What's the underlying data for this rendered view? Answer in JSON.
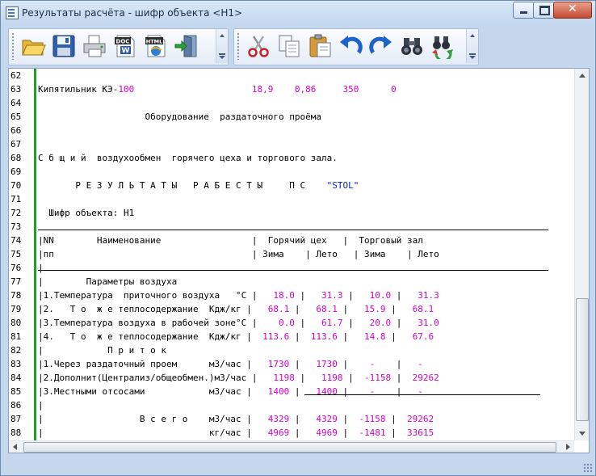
{
  "window": {
    "title": "Результаты расчёта - шифр объекта <Н1>"
  },
  "toolbar1": [
    {
      "name": "open-folder"
    },
    {
      "name": "save"
    },
    {
      "name": "print"
    },
    {
      "name": "export-doc",
      "label": "DOC"
    },
    {
      "name": "export-html",
      "label": "HTML"
    },
    {
      "name": "exit"
    }
  ],
  "toolbar2": [
    {
      "name": "cut"
    },
    {
      "name": "copy"
    },
    {
      "name": "paste"
    },
    {
      "name": "undo"
    },
    {
      "name": "redo"
    },
    {
      "name": "find"
    },
    {
      "name": "find-replace"
    }
  ],
  "report": {
    "line_numbers": [
      "62",
      "63",
      "64",
      "65",
      "66",
      "67",
      "68",
      "69",
      "70",
      "71",
      "72",
      "73",
      "74",
      "75",
      "76",
      "77",
      "78",
      "79",
      "80",
      "81",
      "82",
      "83",
      "84",
      "85",
      "86",
      "87",
      "88"
    ],
    "lines": [
      [],
      [
        {
          "t": "Кипятильник КЭ-"
        },
        {
          "t": "100",
          "c": "m"
        },
        {
          "t": "                      "
        },
        {
          "t": "18,9    0,86     350      0",
          "c": "m"
        }
      ],
      [],
      [
        {
          "t": "                    Оборудование  раздаточного проёма"
        }
      ],
      [],
      [],
      [
        {
          "t": "С б щ и й  воздухообмен  горячего цеха и торгового зала."
        }
      ],
      [],
      [
        {
          "t": "       Р Е З У Л Ь Т А Т Ы   Р А Б Е С Т Ы     П С    "
        },
        {
          "t": "\"STOL\"",
          "c": "b"
        }
      ],
      [],
      [
        {
          "t": "  Шифр объекта: Н1"
        }
      ],
      [],
      [
        {
          "t": "|NN        Наименование                 |  Горячий цех   |  Торговый зал"
        }
      ],
      [
        {
          "t": "|пп                                     | Зима    | Лето   | Зима    | Лето"
        }
      ],
      [
        {
          "t": "|"
        }
      ],
      [
        {
          "t": "|        Параметры воздуха"
        }
      ],
      [
        {
          "t": "|1.Температура  приточного воздуха   °С |   "
        },
        {
          "t": "18.0",
          "c": "m"
        },
        {
          "t": " |   "
        },
        {
          "t": "31.3",
          "c": "m"
        },
        {
          "t": " |   "
        },
        {
          "t": "10.0",
          "c": "m"
        },
        {
          "t": " |   "
        },
        {
          "t": "31.3",
          "c": "m"
        }
      ],
      [
        {
          "t": "|2.   Т о  ж е теплосодержание  Кдж/кг |   "
        },
        {
          "t": "68.1",
          "c": "m"
        },
        {
          "t": " |   "
        },
        {
          "t": "68.1",
          "c": "m"
        },
        {
          "t": " |   "
        },
        {
          "t": "15.9",
          "c": "m"
        },
        {
          "t": " |   "
        },
        {
          "t": "68.1",
          "c": "m"
        }
      ],
      [
        {
          "t": "|3.Температура воздуха в рабочей зоне°С |    "
        },
        {
          "t": "0.0",
          "c": "m"
        },
        {
          "t": " |   "
        },
        {
          "t": "61.7",
          "c": "m"
        },
        {
          "t": " |   "
        },
        {
          "t": "20.0",
          "c": "m"
        },
        {
          "t": " |   "
        },
        {
          "t": "31.0",
          "c": "m"
        }
      ],
      [
        {
          "t": "|4.   Т о  ж е теплосодержание  Кдж/кг |  "
        },
        {
          "t": "113.6",
          "c": "m"
        },
        {
          "t": " |  "
        },
        {
          "t": "113.6",
          "c": "m"
        },
        {
          "t": " |   "
        },
        {
          "t": "14.8",
          "c": "m"
        },
        {
          "t": " |   "
        },
        {
          "t": "67.6",
          "c": "m"
        }
      ],
      [
        {
          "t": "|            П р и т о к"
        }
      ],
      [
        {
          "t": "|1.Через раздаточный проем      м3/час |   "
        },
        {
          "t": "1730",
          "c": "m"
        },
        {
          "t": " |   "
        },
        {
          "t": "1730",
          "c": "m"
        },
        {
          "t": " |    "
        },
        {
          "t": "-",
          "c": "m"
        },
        {
          "t": "    |   "
        },
        {
          "t": "-",
          "c": "m"
        }
      ],
      [
        {
          "t": "|2.Дополнит(Централиз/общеобмен.)м3/час |   "
        },
        {
          "t": "1198",
          "c": "m"
        },
        {
          "t": " |   "
        },
        {
          "t": "1198",
          "c": "m"
        },
        {
          "t": " |  "
        },
        {
          "t": "-1158",
          "c": "m"
        },
        {
          "t": " |  "
        },
        {
          "t": "29262",
          "c": "m"
        }
      ],
      [
        {
          "t": "|3.Местными отсосами            м3/час |   "
        },
        {
          "t": "1400",
          "c": "m"
        },
        {
          "t": " |   "
        },
        {
          "t": "1400",
          "c": "m"
        },
        {
          "t": " |    "
        },
        {
          "t": "-",
          "c": "m"
        },
        {
          "t": "    |   "
        },
        {
          "t": "-",
          "c": "m"
        }
      ],
      [
        {
          "t": "|"
        }
      ],
      [
        {
          "t": "|                  В с е г о    м3/час |   "
        },
        {
          "t": "4329",
          "c": "m"
        },
        {
          "t": " |   "
        },
        {
          "t": "4329",
          "c": "m"
        },
        {
          "t": " |  "
        },
        {
          "t": "-1158",
          "c": "m"
        },
        {
          "t": " |  "
        },
        {
          "t": "29262",
          "c": "m"
        }
      ],
      [
        {
          "t": "|                               кг/час |   "
        },
        {
          "t": "4969",
          "c": "m"
        },
        {
          "t": " |   "
        },
        {
          "t": "4969",
          "c": "m"
        },
        {
          "t": " |  "
        },
        {
          "t": "-1481",
          "c": "m"
        },
        {
          "t": " |  "
        },
        {
          "t": "33615",
          "c": "m"
        }
      ]
    ]
  }
}
